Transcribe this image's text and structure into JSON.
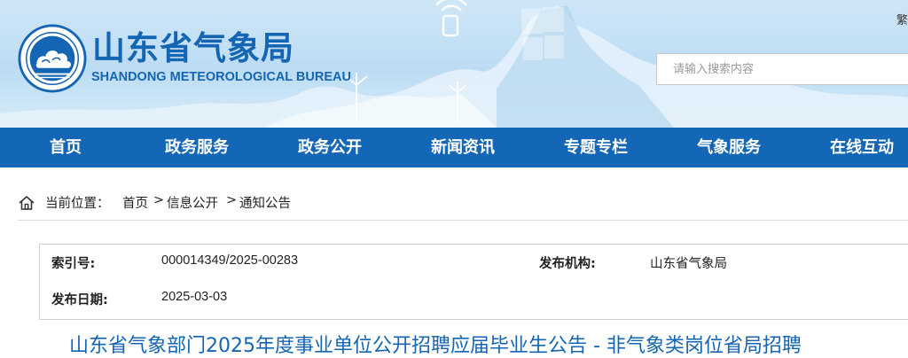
{
  "header": {
    "title": "山东省气象局",
    "subtitle": "SHANDONG METEOROLOGICAL BUREAU",
    "logo_icon": "cma-cloud-emblem-icon",
    "search_placeholder": "请输入搜索内容",
    "corner_glyph": "繁"
  },
  "nav": {
    "items": [
      {
        "label": "首页"
      },
      {
        "label": "政务服务"
      },
      {
        "label": "政务公开"
      },
      {
        "label": "新闻资讯"
      },
      {
        "label": "专题专栏"
      },
      {
        "label": "气象服务"
      },
      {
        "label": "在线互动"
      }
    ]
  },
  "breadcrumb": {
    "icon": "home-icon",
    "prefix": "当前位置：",
    "items": [
      "首页",
      "信息公开",
      "通知公告"
    ],
    "separator": ">"
  },
  "meta": {
    "index_label": "索引号:",
    "index_value": "000014349/2025-00283",
    "org_label": "发布机构:",
    "org_value": "山东省气象局",
    "date_label": "发布日期:",
    "date_value": "2025-03-03"
  },
  "article": {
    "title": "山东省气象部门2025年度事业单位公开招聘应届毕业生公告 - 非气象类岗位省局招聘"
  },
  "colors": {
    "brand_blue": "#1565b5",
    "nav_blue": "#1466b6",
    "header_sky": "#cfe6f7"
  }
}
